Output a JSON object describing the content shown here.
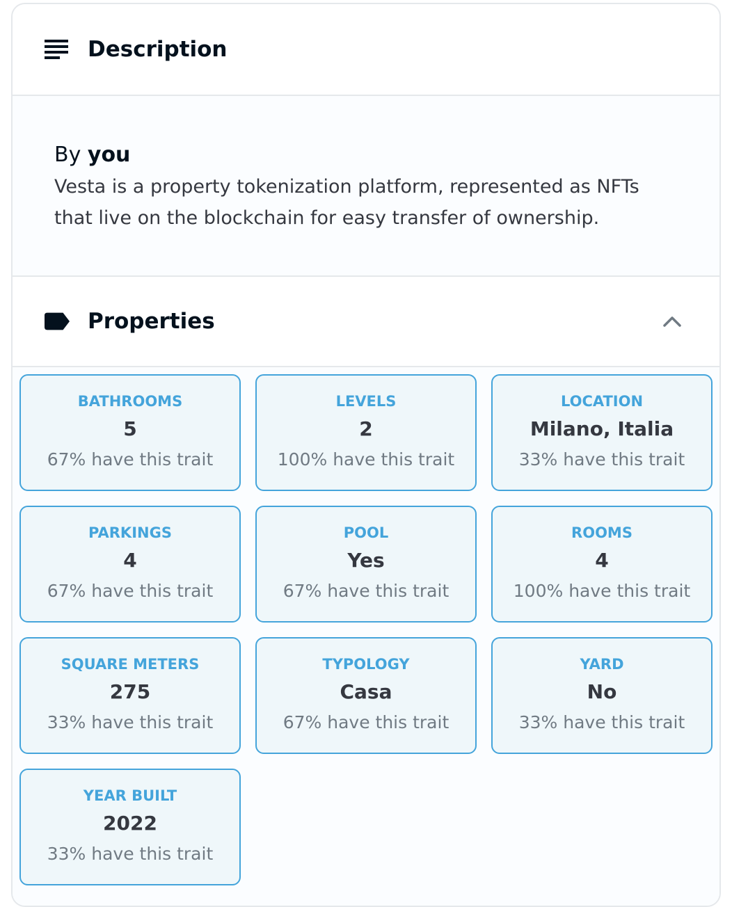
{
  "description": {
    "title": "Description",
    "icon": "subject-lines-icon",
    "by_prefix": "By",
    "creator": "you",
    "text": "Vesta is a property tokenization platform, represented as NFTs that live on the blockchain for easy transfer of ownership."
  },
  "properties": {
    "title": "Properties",
    "icon": "label-tag-icon",
    "toggle_icon": "chevron-up-icon",
    "colors": {
      "accent": "#44a4db",
      "card_bg": "#eff7fa"
    },
    "traits": [
      {
        "type": "BATHROOMS",
        "value": "5",
        "rarity": "67% have this trait"
      },
      {
        "type": "LEVELS",
        "value": "2",
        "rarity": "100% have this trait"
      },
      {
        "type": "LOCATION",
        "value": "Milano, Italia",
        "rarity": "33% have this trait"
      },
      {
        "type": "PARKINGS",
        "value": "4",
        "rarity": "67% have this trait"
      },
      {
        "type": "POOL",
        "value": "Yes",
        "rarity": "67% have this trait"
      },
      {
        "type": "ROOMS",
        "value": "4",
        "rarity": "100% have this trait"
      },
      {
        "type": "SQUARE METERS",
        "value": "275",
        "rarity": "33% have this trait"
      },
      {
        "type": "TYPOLOGY",
        "value": "Casa",
        "rarity": "67% have this trait"
      },
      {
        "type": "YARD",
        "value": "No",
        "rarity": "33% have this trait"
      },
      {
        "type": "YEAR BUILT",
        "value": "2022",
        "rarity": "33% have this trait"
      }
    ]
  }
}
